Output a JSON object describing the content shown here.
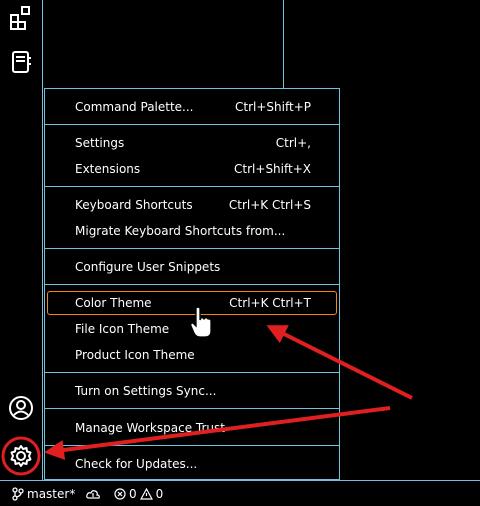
{
  "activity_bar": {
    "icons": [
      "extensions-icon",
      "notebook-icon",
      "account-icon",
      "manage-gear-icon"
    ]
  },
  "menu": {
    "items": [
      {
        "label": "Command Palette...",
        "keybinding": "Ctrl+Shift+P"
      },
      {
        "label": "Settings",
        "keybinding": "Ctrl+,"
      },
      {
        "label": "Extensions",
        "keybinding": "Ctrl+Shift+X"
      },
      {
        "label": "Keyboard Shortcuts",
        "keybinding": "Ctrl+K Ctrl+S"
      },
      {
        "label": "Migrate Keyboard Shortcuts from...",
        "keybinding": ""
      },
      {
        "label": "Configure User Snippets",
        "keybinding": ""
      },
      {
        "label": "Color Theme",
        "keybinding": "Ctrl+K Ctrl+T"
      },
      {
        "label": "File Icon Theme",
        "keybinding": ""
      },
      {
        "label": "Product Icon Theme",
        "keybinding": ""
      },
      {
        "label": "Turn on Settings Sync...",
        "keybinding": ""
      },
      {
        "label": "Manage Workspace Trust",
        "keybinding": ""
      },
      {
        "label": "Check for Updates...",
        "keybinding": ""
      }
    ],
    "focused_item": "Color Theme"
  },
  "status_bar": {
    "branch": "master*",
    "errors": "0",
    "warnings": "0"
  },
  "colors": {
    "background": "#000000",
    "border": "#6fc3df",
    "focus_border": "#f38518",
    "annotation": "#e02020"
  }
}
